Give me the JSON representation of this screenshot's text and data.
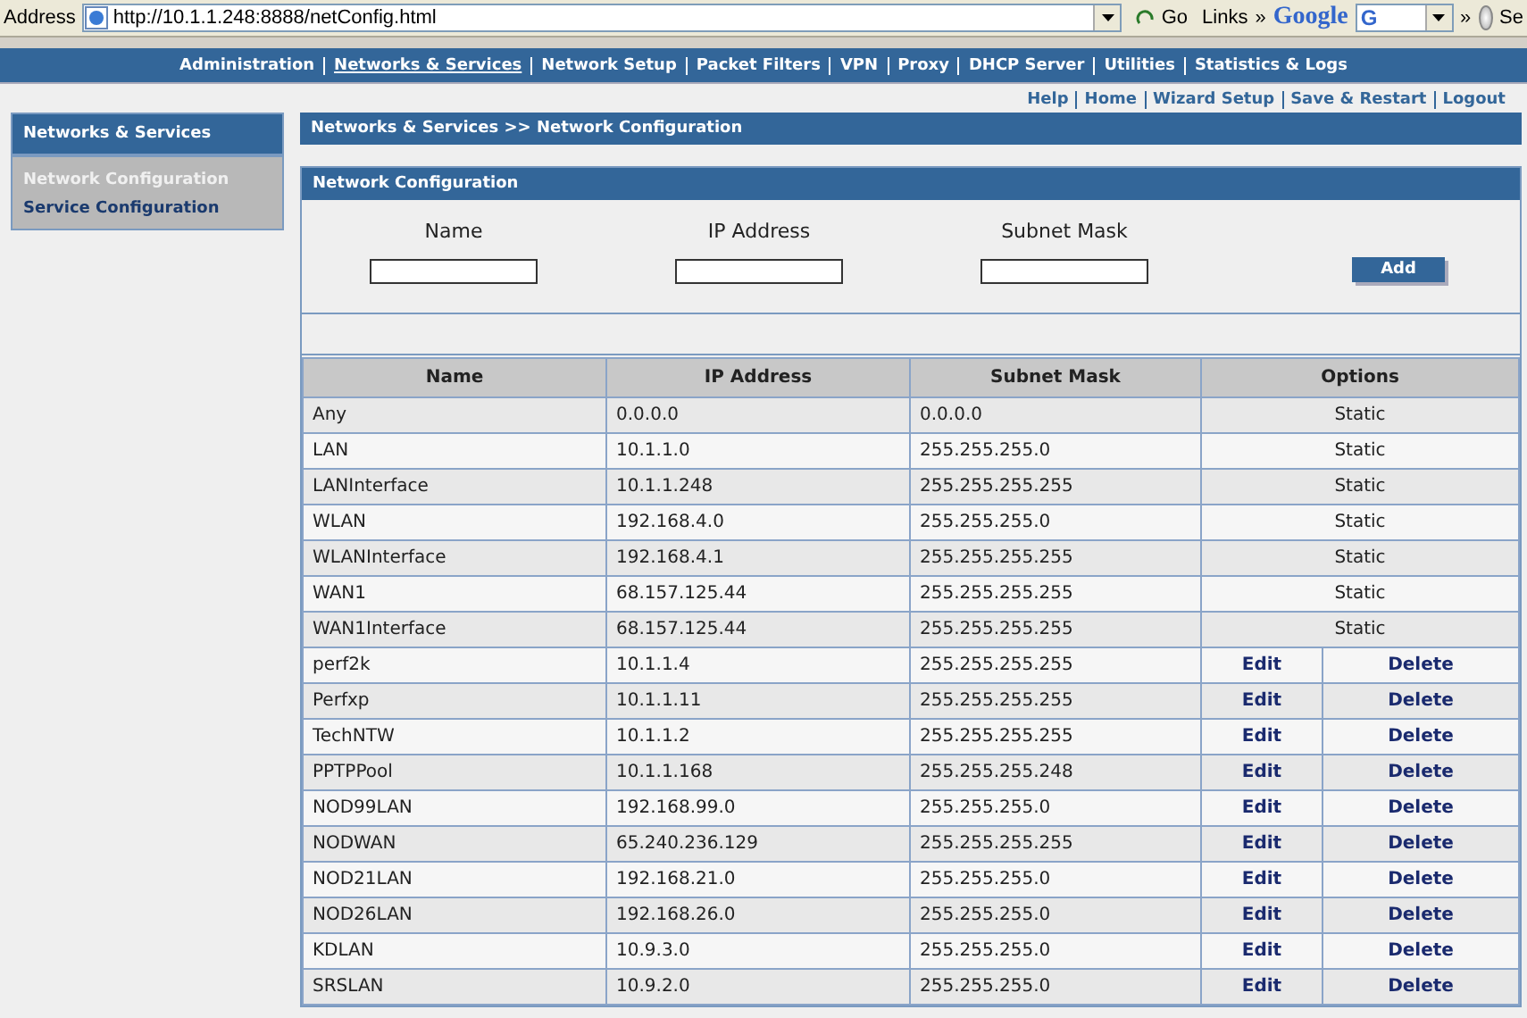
{
  "browser": {
    "address_label": "Address",
    "url": "http://10.1.1.248:8888/netConfig.html",
    "go": "Go",
    "links": "Links",
    "links_more": "»",
    "search_logo": "Google",
    "search_letter": "G",
    "more": "»",
    "cut_label": "Se"
  },
  "nav": [
    {
      "label": "Administration",
      "selected": false
    },
    {
      "label": "Networks & Services",
      "selected": true
    },
    {
      "label": "Network Setup",
      "selected": false
    },
    {
      "label": "Packet Filters",
      "selected": false
    },
    {
      "label": "VPN",
      "selected": false
    },
    {
      "label": "Proxy",
      "selected": false
    },
    {
      "label": "DHCP Server",
      "selected": false
    },
    {
      "label": "Utilities",
      "selected": false
    },
    {
      "label": "Statistics & Logs",
      "selected": false
    }
  ],
  "utility_links": [
    "Help",
    "Home",
    "Wizard Setup",
    "Save & Restart",
    "Logout"
  ],
  "sidebar": {
    "title": "Networks & Services",
    "items": [
      {
        "label": "Network Configuration",
        "selected": true
      },
      {
        "label": "Service Configuration",
        "selected": false
      }
    ]
  },
  "breadcrumb": "Networks & Services >> Network Configuration",
  "form": {
    "title": "Network Configuration",
    "fields": [
      {
        "label": "Name"
      },
      {
        "label": "IP Address"
      },
      {
        "label": "Subnet Mask"
      }
    ],
    "button": "Add"
  },
  "table": {
    "columns": [
      "Name",
      "IP Address",
      "Subnet Mask",
      "Options"
    ],
    "rows": [
      {
        "kind": "static",
        "name": "Any",
        "ip": "0.0.0.0",
        "mask": "0.0.0.0",
        "options": [
          "Static"
        ]
      },
      {
        "kind": "static",
        "name": "LAN",
        "ip": "10.1.1.0",
        "mask": "255.255.255.0",
        "options": [
          "Static"
        ]
      },
      {
        "kind": "static",
        "name": "LANInterface",
        "ip": "10.1.1.248",
        "mask": "255.255.255.255",
        "options": [
          "Static"
        ]
      },
      {
        "kind": "static",
        "name": "WLAN",
        "ip": "192.168.4.0",
        "mask": "255.255.255.0",
        "options": [
          "Static"
        ]
      },
      {
        "kind": "static",
        "name": "WLANInterface",
        "ip": "192.168.4.1",
        "mask": "255.255.255.255",
        "options": [
          "Static"
        ]
      },
      {
        "kind": "static",
        "name": "WAN1",
        "ip": "68.157.125.44",
        "mask": "255.255.255.255",
        "options": [
          "Static"
        ]
      },
      {
        "kind": "static",
        "name": "WAN1Interface",
        "ip": "68.157.125.44",
        "mask": "255.255.255.255",
        "options": [
          "Static"
        ]
      },
      {
        "kind": "custom",
        "name": "perf2k",
        "ip": "10.1.1.4",
        "mask": "255.255.255.255",
        "options": [
          "Edit",
          "Delete"
        ]
      },
      {
        "kind": "custom",
        "name": "Perfxp",
        "ip": "10.1.1.11",
        "mask": "255.255.255.255",
        "options": [
          "Edit",
          "Delete"
        ]
      },
      {
        "kind": "custom",
        "name": "TechNTW",
        "ip": "10.1.1.2",
        "mask": "255.255.255.255",
        "options": [
          "Edit",
          "Delete"
        ]
      },
      {
        "kind": "custom",
        "name": "PPTPPool",
        "ip": "10.1.1.168",
        "mask": "255.255.255.248",
        "options": [
          "Edit",
          "Delete"
        ]
      },
      {
        "kind": "custom",
        "name": "NOD99LAN",
        "ip": "192.168.99.0",
        "mask": "255.255.255.0",
        "options": [
          "Edit",
          "Delete"
        ]
      },
      {
        "kind": "custom",
        "name": "NODWAN",
        "ip": "65.240.236.129",
        "mask": "255.255.255.255",
        "options": [
          "Edit",
          "Delete"
        ]
      },
      {
        "kind": "custom",
        "name": "NOD21LAN",
        "ip": "192.168.21.0",
        "mask": "255.255.255.0",
        "options": [
          "Edit",
          "Delete"
        ]
      },
      {
        "kind": "custom",
        "name": "NOD26LAN",
        "ip": "192.168.26.0",
        "mask": "255.255.255.0",
        "options": [
          "Edit",
          "Delete"
        ]
      },
      {
        "kind": "custom",
        "name": "KDLAN",
        "ip": "10.9.3.0",
        "mask": "255.255.255.0",
        "options": [
          "Edit",
          "Delete"
        ]
      },
      {
        "kind": "custom",
        "name": "SRSLAN",
        "ip": "10.9.2.0",
        "mask": "255.255.255.0",
        "options": [
          "Edit",
          "Delete"
        ]
      }
    ]
  }
}
